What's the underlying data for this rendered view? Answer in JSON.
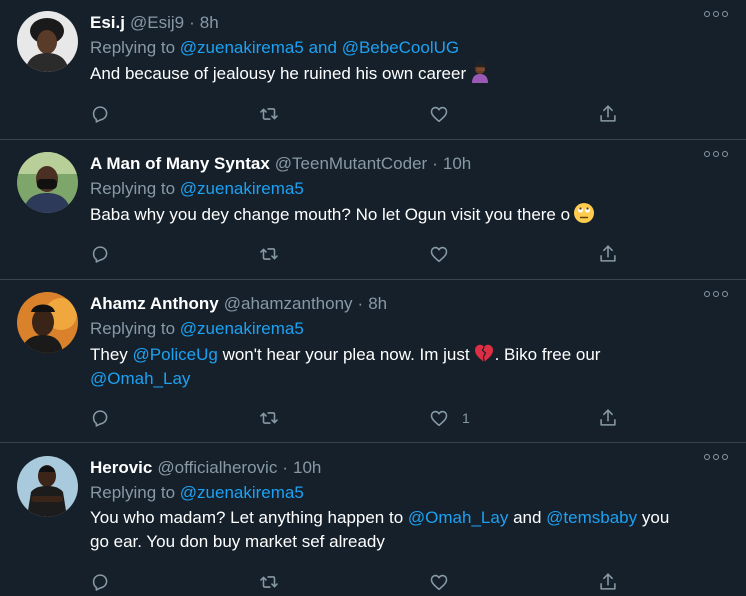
{
  "colors": {
    "background": "#15202b",
    "text": "#ffffff",
    "secondary": "#8899a6",
    "link": "#1da1f2",
    "divider": "#38444d"
  },
  "tweets": [
    {
      "name": "Esi.j",
      "handle": "@Esij9",
      "separator": "·",
      "time": "8h",
      "replying_prefix": "Replying to",
      "replying_to_1": "@zuenakirema5",
      "replying_and": "and",
      "replying_to_2": "@BebeCoolUG",
      "text": "And because of jealousy he ruined his own career",
      "emoji": "woman-facepalming-emoji",
      "actions": {
        "reply": "reply-icon",
        "retweet": "retweet-icon",
        "like": "heart-icon",
        "share": "share-icon"
      }
    },
    {
      "name": "A Man of Many Syntax",
      "handle": "@TeenMutantCoder",
      "separator": "·",
      "time": "10h",
      "replying_prefix": "Replying to",
      "replying_to_1": "@zuenakirema5",
      "text": "Baba why you dey change mouth? No let Ogun visit you there o",
      "emoji": "face-with-rolling-eyes-emoji",
      "actions": {
        "reply": "reply-icon",
        "retweet": "retweet-icon",
        "like": "heart-icon",
        "share": "share-icon"
      }
    },
    {
      "name": "Ahamz Anthony",
      "handle": "@ahamzanthony",
      "separator": "·",
      "time": "8h",
      "replying_prefix": "Replying to",
      "replying_to_1": "@zuenakirema5",
      "text_part1": "They",
      "mention_1": "@PoliceUg",
      "text_part2": "won't hear your plea now. Im just",
      "emoji": "broken-heart-emoji",
      "text_part3": ". Biko free our",
      "mention_2": "@Omah_Lay",
      "like_count": "1",
      "actions": {
        "reply": "reply-icon",
        "retweet": "retweet-icon",
        "like": "heart-icon",
        "share": "share-icon"
      }
    },
    {
      "name": "Herovic",
      "handle": "@officialherovic",
      "separator": "·",
      "time": "10h",
      "replying_prefix": "Replying to",
      "replying_to_1": "@zuenakirema5",
      "text_part1": "You who madam? Let anything happen to",
      "mention_1": "@Omah_Lay",
      "text_part2": "and",
      "mention_2": "@temsbaby",
      "text_part3": "you",
      "text_line2": "go ear. You don buy market sef already",
      "actions": {
        "reply": "reply-icon",
        "retweet": "retweet-icon",
        "like": "heart-icon",
        "share": "share-icon"
      }
    }
  ]
}
